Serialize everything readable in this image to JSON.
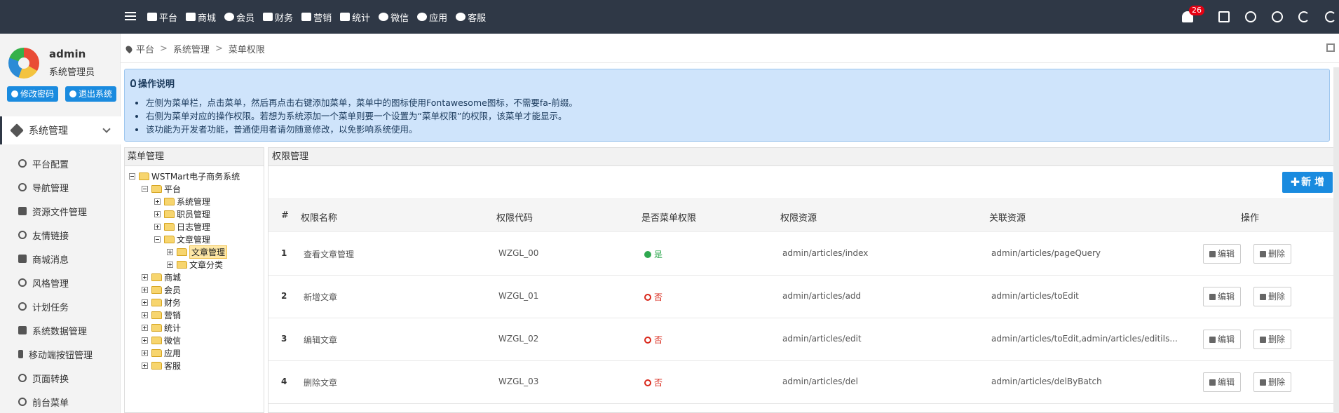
{
  "topnav": {
    "items": [
      {
        "label": "平台",
        "icon": "monitor-icon"
      },
      {
        "label": "商城",
        "icon": "cart-icon"
      },
      {
        "label": "会员",
        "icon": "user-icon"
      },
      {
        "label": "财务",
        "icon": "truck-icon"
      },
      {
        "label": "营销",
        "icon": "gift-icon"
      },
      {
        "label": "统计",
        "icon": "line-chart-icon"
      },
      {
        "label": "微信",
        "icon": "wechat-icon"
      },
      {
        "label": "应用",
        "icon": "cloud-icon"
      },
      {
        "label": "客服",
        "icon": "comment-icon"
      }
    ],
    "notification_count": "26"
  },
  "profile": {
    "name": "admin",
    "role": "系统管理员",
    "change_password": "修改密码",
    "logout": "退出系统"
  },
  "sidebar": {
    "section": "系统管理",
    "items": [
      {
        "label": "平台配置"
      },
      {
        "label": "导航管理"
      },
      {
        "label": "资源文件管理"
      },
      {
        "label": "友情链接"
      },
      {
        "label": "商城消息"
      },
      {
        "label": "风格管理"
      },
      {
        "label": "计划任务"
      },
      {
        "label": "系统数据管理"
      },
      {
        "label": "移动端按钮管理"
      },
      {
        "label": "页面转换"
      },
      {
        "label": "前台菜单"
      }
    ]
  },
  "breadcrumb": {
    "a": "平台",
    "b": "系统管理",
    "c": "菜单权限",
    "sep": ">"
  },
  "info": {
    "title": "操作说明",
    "lines": [
      "左侧为菜单栏，点击菜单，然后再点击右键添加菜单，菜单中的图标使用Fontawesome图标，不需要fa-前缀。",
      "右侧为菜单对应的操作权限。若想为系统添加一个菜单则要一个设置为“菜单权限”的权限，该菜单才能显示。",
      "该功能为开发者功能，普通使用者请勿随意修改，以免影响系统使用。"
    ]
  },
  "tree": {
    "title": "菜单管理",
    "nodes": [
      {
        "label": "WSTMart电子商务系统"
      },
      {
        "label": "平台"
      },
      {
        "label": "系统管理"
      },
      {
        "label": "职员管理"
      },
      {
        "label": "日志管理"
      },
      {
        "label": "文章管理"
      },
      {
        "label": "文章管理"
      },
      {
        "label": "文章分类"
      },
      {
        "label": "商城"
      },
      {
        "label": "会员"
      },
      {
        "label": "财务"
      },
      {
        "label": "营销"
      },
      {
        "label": "统计"
      },
      {
        "label": "微信"
      },
      {
        "label": "应用"
      },
      {
        "label": "客服"
      }
    ]
  },
  "perm": {
    "title": "权限管理",
    "add_label": "新 增",
    "headers": [
      "#",
      "权限名称",
      "权限代码",
      "是否菜单权限",
      "权限资源",
      "关联资源",
      "操作"
    ],
    "edit_label": "编辑",
    "delete_label": "删除",
    "rows": [
      {
        "no": "1",
        "name": "查看文章管理",
        "code": "WZGL_00",
        "is_menu": "是",
        "menu": true,
        "resource": "admin/articles/index",
        "related": "admin/articles/pageQuery"
      },
      {
        "no": "2",
        "name": "新增文章",
        "code": "WZGL_01",
        "is_menu": "否",
        "menu": false,
        "resource": "admin/articles/add",
        "related": "admin/articles/toEdit"
      },
      {
        "no": "3",
        "name": "编辑文章",
        "code": "WZGL_02",
        "is_menu": "否",
        "menu": false,
        "resource": "admin/articles/edit",
        "related": "admin/articles/toEdit,admin/articles/editiIs..."
      },
      {
        "no": "4",
        "name": "删除文章",
        "code": "WZGL_03",
        "is_menu": "否",
        "menu": false,
        "resource": "admin/articles/del",
        "related": "admin/articles/delByBatch"
      }
    ]
  },
  "colors": {
    "topbar": "#2f3846",
    "accent": "#1a8bdf",
    "info_bg": "#cfe4fb",
    "yes": "#2fa84f",
    "no": "#d9281b"
  }
}
